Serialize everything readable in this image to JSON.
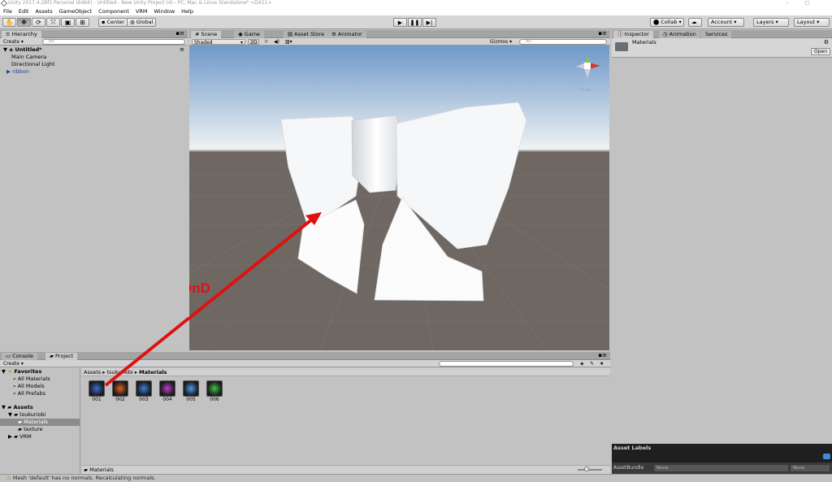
{
  "window": {
    "title": "Unity 2017.4.28f1 Personal (64bit) - Untitled - New Unity Project (4) - PC, Mac & Linux Standalone* <DX11>"
  },
  "menu": [
    "File",
    "Edit",
    "Assets",
    "GameObject",
    "Component",
    "VRM",
    "Window",
    "Help"
  ],
  "toolbar": {
    "pivot_label": "Center",
    "space_label": "Global",
    "collab_label": "Collab",
    "account_label": "Account",
    "layers_label": "Layers",
    "layout_label": "Layout"
  },
  "hierarchy": {
    "tab": "Hierarchy",
    "create": "Create",
    "search_placeholder": "All",
    "scene": "Untitled*",
    "items": [
      "Main Camera",
      "Directional Light",
      "ribbon"
    ]
  },
  "scene": {
    "tabs": [
      "Scene",
      "Game",
      "Asset Store",
      "Animator"
    ],
    "shading": "Shaded",
    "mode_2d": "2D",
    "gizmos": "Gizmos",
    "search_placeholder": "All",
    "gizmo_persp": "Persp",
    "annotation_text": "DnD",
    "annotation_color": "#e01010",
    "sky_top": "#6f98c9",
    "horizon": "#eef2f3",
    "ground": "#6e6762",
    "ribbon_color": "#ffffff"
  },
  "inspector": {
    "tabs": [
      "Inspector",
      "Animation",
      "Services"
    ],
    "object_name": "Materials",
    "open_label": "Open",
    "asset_labels": "Asset Labels",
    "assetbundle_label": "AssetBundle",
    "assetbundle_value": "None",
    "assetbundle_variant": "None"
  },
  "project": {
    "tabs": [
      "Console",
      "Project"
    ],
    "create": "Create",
    "favorites_label": "Favorites",
    "favorites": [
      "All Materials",
      "All Models",
      "All Prefabs"
    ],
    "assets_label": "Assets",
    "folders": [
      "tsukuriobi",
      "Materials",
      "texture",
      "VRM"
    ],
    "breadcrumb": [
      "Assets",
      "tsukuriobi",
      "Materials"
    ],
    "materials": [
      {
        "name": "001",
        "color": "#3b6fd6"
      },
      {
        "name": "002",
        "color": "#d8641e"
      },
      {
        "name": "003",
        "color": "#3a7ee0"
      },
      {
        "name": "004",
        "color": "#c03bd0"
      },
      {
        "name": "005",
        "color": "#4a9cf0"
      },
      {
        "name": "006",
        "color": "#3ec63e"
      }
    ],
    "footer_path": "Materials"
  },
  "status": {
    "message": "Mesh 'default' has no normals. Recalculating normals."
  }
}
